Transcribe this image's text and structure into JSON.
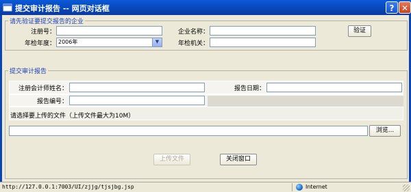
{
  "window": {
    "title": "提交审计报告 -- 网页对话框",
    "help_glyph": "?",
    "close_glyph": "✕"
  },
  "verify_section": {
    "legend": "请先验证要提交报告的企业",
    "reg_no_label": "注册号：",
    "reg_no_value": "",
    "company_name_label": "企业名称：",
    "company_name_value": "",
    "year_label": "年检年度：",
    "year_value": "2006年",
    "authority_label": "年检机关：",
    "authority_value": "",
    "verify_button": "验证"
  },
  "report_section": {
    "legend": "提交审计报告",
    "accountant_label": "注册会计师姓名：",
    "accountant_value": "",
    "report_date_label": "报告日期：",
    "report_date_value": "",
    "report_no_label": "报告编号：",
    "report_no_value": "",
    "file_prompt": "请选择要上传的文件（上传文件最大为10M）",
    "file_value": "",
    "browse_button": "浏览...",
    "upload_button": "上传文件",
    "close_button": "关闭窗口"
  },
  "statusbar": {
    "url": "http://127.0.0.1:7003/UI/zjjg/tjsjbg.jsp",
    "zone": "Internet"
  }
}
